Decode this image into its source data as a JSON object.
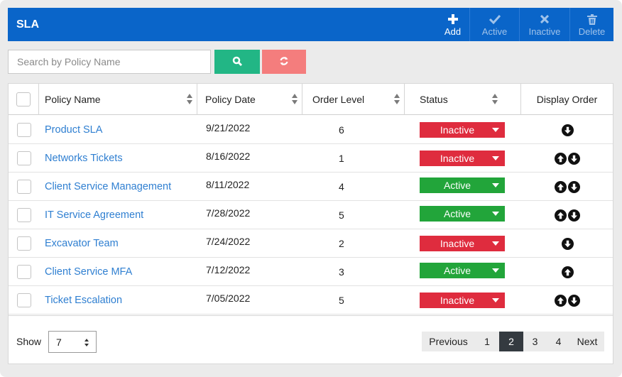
{
  "header": {
    "title": "SLA",
    "actions": [
      {
        "label": "Add",
        "icon": "plus-icon",
        "enabled": true
      },
      {
        "label": "Active",
        "icon": "check-icon",
        "enabled": false
      },
      {
        "label": "Inactive",
        "icon": "x-icon",
        "enabled": false
      },
      {
        "label": "Delete",
        "icon": "trash-icon",
        "enabled": false
      }
    ],
    "color": "#0a65c9"
  },
  "search": {
    "placeholder": "Search by Policy Name",
    "value": "",
    "search_icon": "search-icon",
    "reset_icon": "refresh-icon",
    "search_color": "#22b685",
    "reset_color": "#f47d7d"
  },
  "table": {
    "columns": [
      "Policy Name",
      "Policy Date",
      "Order Level",
      "Status",
      "Display Order"
    ],
    "rows": [
      {
        "name": "Product SLA",
        "date": "9/21/2022",
        "level": "6",
        "status": "Inactive",
        "up": false,
        "down": true
      },
      {
        "name": "Networks Tickets",
        "date": "8/16/2022",
        "level": "1",
        "status": "Inactive",
        "up": true,
        "down": true
      },
      {
        "name": "Client Service Management",
        "date": "8/11/2022",
        "level": "4",
        "status": "Active",
        "up": true,
        "down": true
      },
      {
        "name": "IT Service Agreement",
        "date": "7/28/2022",
        "level": "5",
        "status": "Active",
        "up": true,
        "down": true
      },
      {
        "name": "Excavator Team",
        "date": "7/24/2022",
        "level": "2",
        "status": "Inactive",
        "up": false,
        "down": true
      },
      {
        "name": "Client Service MFA",
        "date": "7/12/2022",
        "level": "3",
        "status": "Active",
        "up": true,
        "down": false
      },
      {
        "name": "Ticket Escalation",
        "date": "7/05/2022",
        "level": "5",
        "status": "Inactive",
        "up": true,
        "down": true
      }
    ],
    "status_colors": {
      "Active": "#22a53a",
      "Inactive": "#df2c3e"
    }
  },
  "footer": {
    "show_label": "Show",
    "page_size": "7",
    "pager": {
      "previous": "Previous",
      "pages": [
        "1",
        "2",
        "3",
        "4"
      ],
      "current": "2",
      "next": "Next"
    }
  }
}
